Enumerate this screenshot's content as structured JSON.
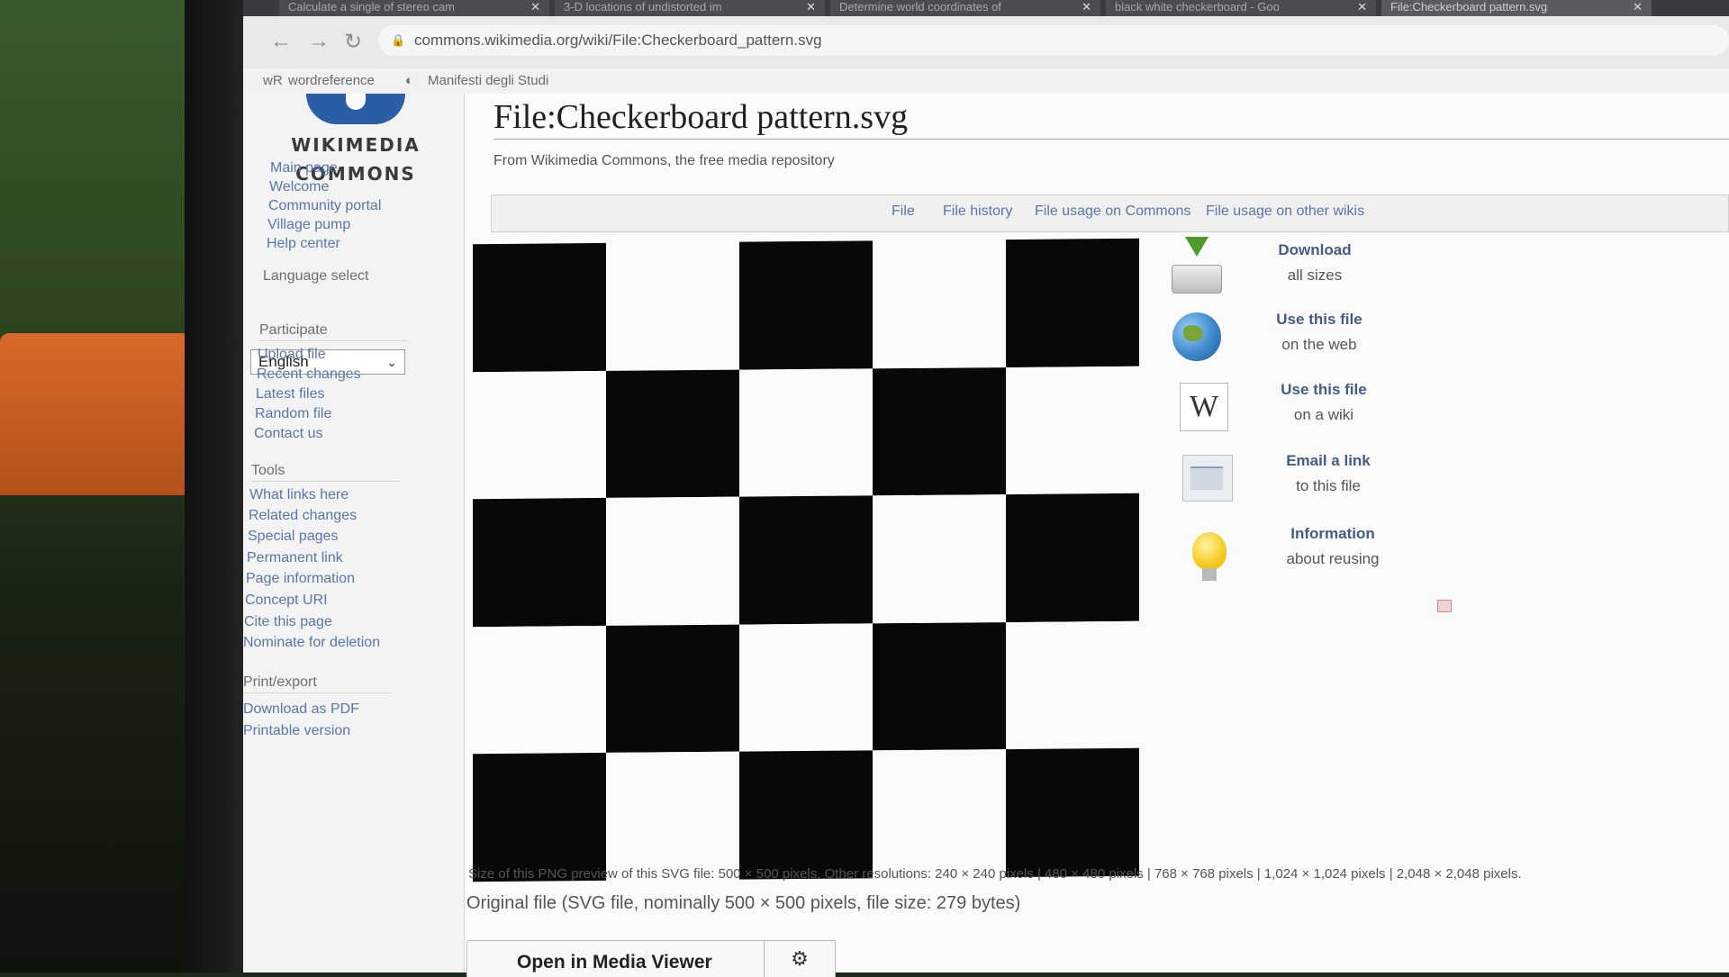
{
  "browser": {
    "tabs": [
      {
        "label": "Calculate a single of stereo cam",
        "close": "✕"
      },
      {
        "label": "3-D locations of undistorted im",
        "close": "✕"
      },
      {
        "label": "Determine world coordinates of",
        "close": "✕"
      },
      {
        "label": "black white checkerboard - Goo",
        "close": "✕"
      },
      {
        "label": "File:Checkerboard pattern.svg",
        "close": "✕"
      }
    ],
    "url": "commons.wikimedia.org/wiki/File:Checkerboard_pattern.svg",
    "bookmarks": [
      "wordreference",
      "Manifesti degli Studi"
    ]
  },
  "logo": {
    "line1": "WIKIMEDIA",
    "line2": "COMMONS"
  },
  "sidebar": {
    "nav": [
      "Main page",
      "Welcome",
      "Community portal",
      "Village pump",
      "Help center"
    ],
    "language_heading": "Language select",
    "language_value": "English",
    "participate_heading": "Participate",
    "participate": [
      "Upload file",
      "Recent changes",
      "Latest files",
      "Random file",
      "Contact us"
    ],
    "tools_heading": "Tools",
    "tools": [
      "What links here",
      "Related changes",
      "Special pages",
      "Permanent link",
      "Page information",
      "Concept URI",
      "Cite this page",
      "Nominate for deletion"
    ],
    "print_heading": "Print/export",
    "print": [
      "Download as PDF",
      "Printable version"
    ]
  },
  "page": {
    "title": "File:Checkerboard pattern.svg",
    "tagline": "From Wikimedia Commons, the free media repository",
    "file_tabs": [
      "File",
      "File history",
      "File usage on Commons",
      "File usage on other wikis"
    ]
  },
  "actions": [
    {
      "icon": "download-icon",
      "line1": "Download",
      "line2": "all sizes"
    },
    {
      "icon": "globe-icon",
      "line1": "Use this file",
      "line2": "on the web"
    },
    {
      "icon": "wiki-icon",
      "line1": "Use this file",
      "line2": "on a wiki"
    },
    {
      "icon": "email-icon",
      "line1": "Email a link",
      "line2": "to this file"
    },
    {
      "icon": "lightbulb-icon",
      "line1": "Information",
      "line2": "about reusing"
    }
  ],
  "wiki_letter": "W",
  "size_info": "Size of this PNG preview of this SVG file: 500 × 500 pixels. Other resolutions: 240 × 240 pixels | 480 × 480 pixels | 768 × 768 pixels | 1,024 × 1,024 pixels | 2,048 × 2,048 pixels.",
  "original_file": "Original file (SVG file, nominally 500 × 500 pixels, file size: 279 bytes)",
  "media_viewer": {
    "label": "Open in Media Viewer",
    "gear": "⚙"
  },
  "colors": {
    "link": "#5877a6",
    "checker_black": "#080808",
    "checker_white": "#fbfbfb"
  }
}
